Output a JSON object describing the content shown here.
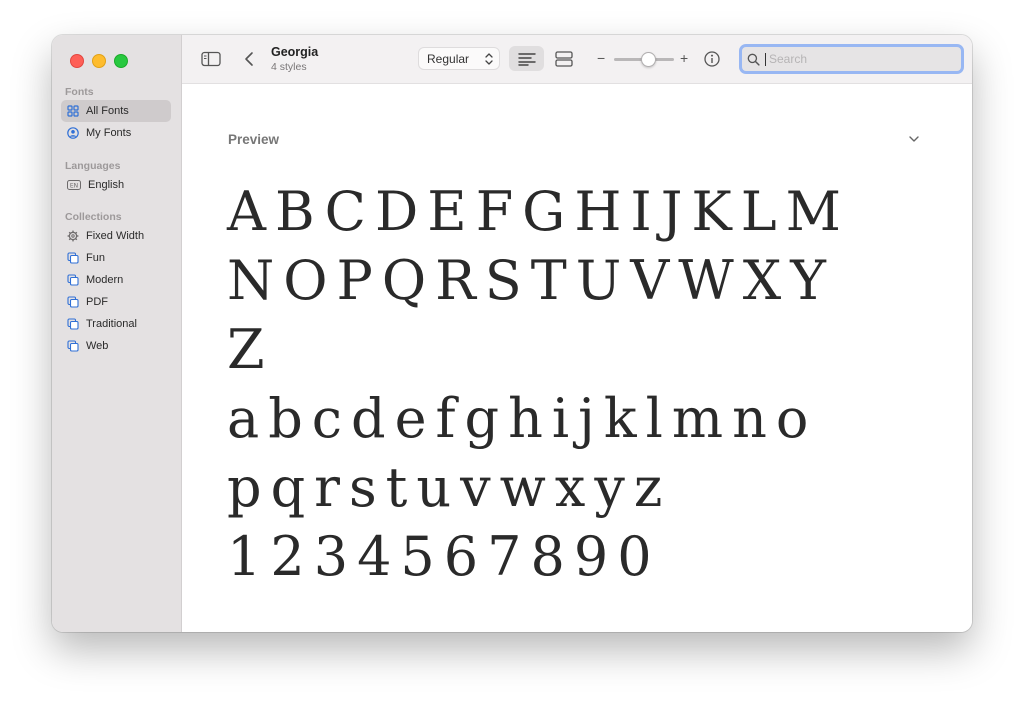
{
  "window": {
    "traffic_lights": {
      "close": "#fe5f57",
      "minimize": "#febc2e",
      "maximize": "#28c840"
    }
  },
  "sidebar": {
    "sections": [
      {
        "title": "Fonts",
        "items": [
          {
            "label": "All Fonts",
            "icon": "grid-icon",
            "selected": true
          },
          {
            "label": "My Fonts",
            "icon": "person-circle-icon",
            "selected": false
          }
        ]
      },
      {
        "title": "Languages",
        "items": [
          {
            "label": "English",
            "icon": "en-badge-icon",
            "badge": "EN",
            "selected": false
          }
        ]
      },
      {
        "title": "Collections",
        "items": [
          {
            "label": "Fixed Width",
            "icon": "gear-icon",
            "selected": false
          },
          {
            "label": "Fun",
            "icon": "collection-icon",
            "selected": false
          },
          {
            "label": "Modern",
            "icon": "collection-icon",
            "selected": false
          },
          {
            "label": "PDF",
            "icon": "collection-icon",
            "selected": false
          },
          {
            "label": "Traditional",
            "icon": "collection-icon",
            "selected": false
          },
          {
            "label": "Web",
            "icon": "collection-icon",
            "selected": false
          }
        ]
      }
    ]
  },
  "toolbar": {
    "font_name": "Georgia",
    "font_styles": "4 styles",
    "style_select": "Regular",
    "size_slider": 0.55,
    "search": {
      "value": "",
      "placeholder": "Search"
    },
    "accent": "#98b7f3"
  },
  "preview": {
    "label": "Preview",
    "lines": [
      "ABCDEFGHIJKLM",
      "NOPQRSTUVWXY",
      "Z",
      "abcdefghijklmno",
      "pqrstuvwxyz",
      "1234567890"
    ]
  }
}
